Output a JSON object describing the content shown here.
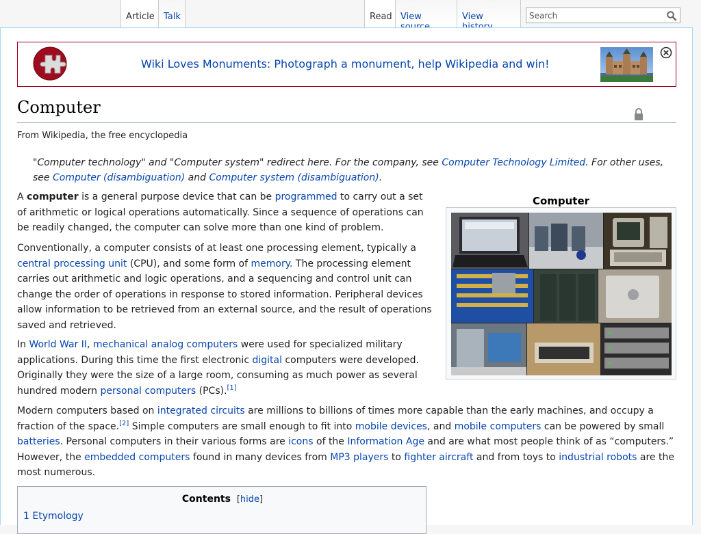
{
  "tabs": {
    "article": "Article",
    "talk": "Talk",
    "read": "Read",
    "view_source": "View source",
    "view_history": "View history"
  },
  "search": {
    "placeholder": "Search"
  },
  "banner": {
    "text": "Wiki Loves Monuments: Photograph a monument, help Wikipedia and win!"
  },
  "page": {
    "title": "Computer",
    "site_sub": "From Wikipedia, the free encyclopedia"
  },
  "hatnote": {
    "t1": "\"Computer technology\" and \"Computer system\" redirect here. For the company, see ",
    "l1": "Computer Technology Limited",
    "t2": ". For other uses, see ",
    "l2": "Computer (disambiguation)",
    "t3": " and ",
    "l3": "Computer system (disambiguation)",
    "t4": "."
  },
  "p1": {
    "t1": "A ",
    "b1": "computer",
    "t2": " is a general purpose device that can be ",
    "l1": "programmed",
    "t3": " to carry out a set of arithmetic or logical operations automatically. Since a sequence of operations can be readily changed, the computer can solve more than one kind of problem."
  },
  "p2": {
    "t1": "Conventionally, a computer consists of at least one processing element, typically a ",
    "l1": "central processing unit",
    "t2": " (CPU), and some form of ",
    "l2": "memory",
    "t3": ". The processing element carries out arithmetic and logic operations, and a sequencing and control unit can change the order of operations in response to stored information. Peripheral devices allow information to be retrieved from an external source, and the result of operations saved and retrieved."
  },
  "p3": {
    "t1": "In ",
    "l1": "World War II",
    "t2": ", ",
    "l2": "mechanical analog computers",
    "t3": " were used for specialized military applications. During this time the first electronic ",
    "l3": "digital",
    "t4": " computers were developed. Originally they were the size of a large room, consuming as much power as several hundred modern ",
    "l4": "personal computers",
    "t5": " (PCs).",
    "ref": "[1]"
  },
  "p4": {
    "t1": "Modern computers based on ",
    "l1": "integrated circuits",
    "t2": " are millions to billions of times more capable than the early machines, and occupy a fraction of the space.",
    "ref": "[2]",
    "t3": " Simple computers are small enough to fit into ",
    "l2": "mobile devices",
    "t4": ", and ",
    "l3": "mobile computers",
    "t5": " can be powered by small ",
    "l4": "batteries",
    "t6": ". Personal computers in their various forms are ",
    "l5": "icons",
    "t7": " of the ",
    "l6": "Information Age",
    "t8": " and are what most people think of as “computers.” However, the ",
    "l7": "embedded computers",
    "t9": " found in many devices from ",
    "l8": "MP3 players",
    "t10": " to ",
    "l9": "fighter aircraft",
    "t11": " and from toys to ",
    "l10": "industrial robots",
    "t12": " are the most numerous."
  },
  "infobox": {
    "title": "Computer"
  },
  "toc": {
    "title": "Contents",
    "bracket_open": "[",
    "hide": "hide",
    "bracket_close": "]",
    "item1_num": "1",
    "item1_label": "Etymology"
  }
}
